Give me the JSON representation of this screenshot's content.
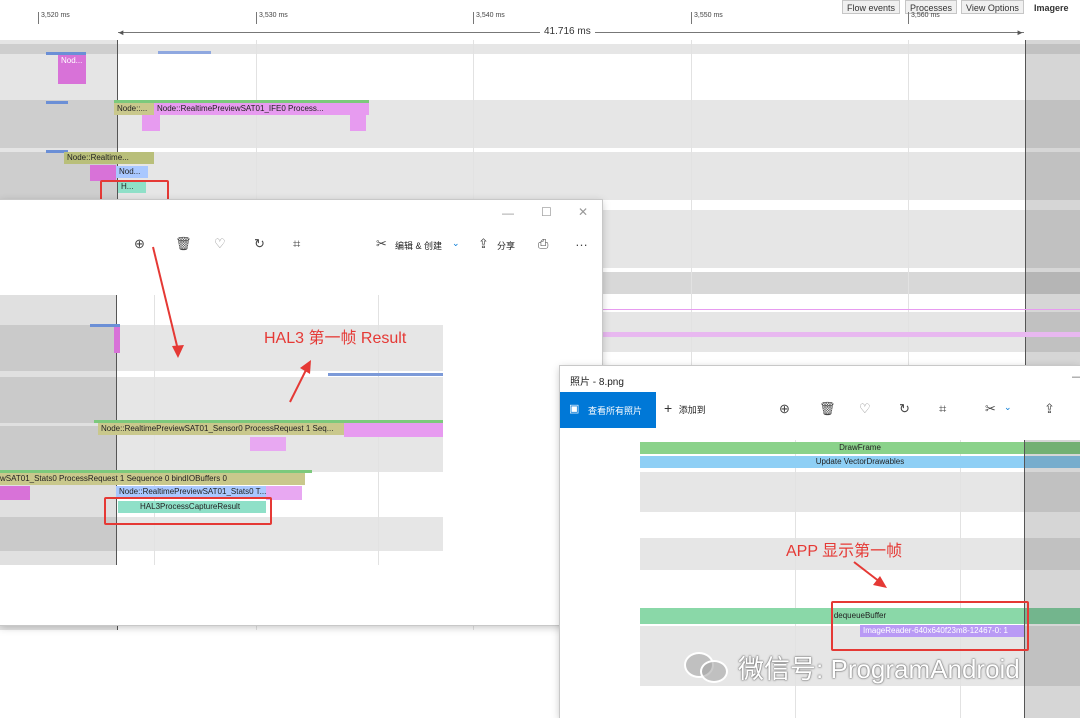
{
  "toolbar": {
    "flow_events": "Flow events",
    "processes": "Processes",
    "view_options": "View Options",
    "imagere": "Imagere"
  },
  "ruler": {
    "ticks": [
      "3,520 ms",
      "3,530 ms",
      "3,540 ms",
      "3,550 ms",
      "3,560 ms"
    ],
    "duration": "41.716 ms"
  },
  "bg_slices": {
    "s1": "Nod...",
    "s2": "Node::...",
    "s3": "Node::RealtimePreviewSAT01_IFE0 Process...",
    "s4": "Node::Realtime...",
    "s5": "Nod...",
    "s6": "H..."
  },
  "photo_win1": {
    "edit_create": "编辑 & 创建",
    "share": "分享",
    "slices": {
      "sensor": "Node::RealtimePreviewSAT01_Sensor0 ProcessRequest 1 Seq...",
      "stats": "wSAT01_Stats0 ProcessRequest 1 Sequence 0 bindIOBuffers 0",
      "stats_node": "Node::RealtimePreviewSAT01_Stats0 T...",
      "hal3": "HAL3ProcessCaptureResult"
    },
    "annotation": "HAL3 第一帧 Result"
  },
  "photo_win2": {
    "title": "照片 - 8.png",
    "view_all": "查看所有照片",
    "add_to": "添加到",
    "slices": {
      "draw_frame": "DrawFrame",
      "update_vd": "Update VectorDrawables",
      "dequeue": "dequeueBuffer",
      "image_reader": "ImageReader-640x640f23m8-12467-0: 1"
    },
    "annotation": "APP 显示第一帧"
  },
  "watermark": "微信号: ProgramAndroid",
  "colors": {
    "annotation_red": "#e53935",
    "accent_blue": "#0078d7",
    "slice_green": "#85d08f",
    "slice_pink": "#e79bf0",
    "slice_olive": "#c4c586"
  }
}
